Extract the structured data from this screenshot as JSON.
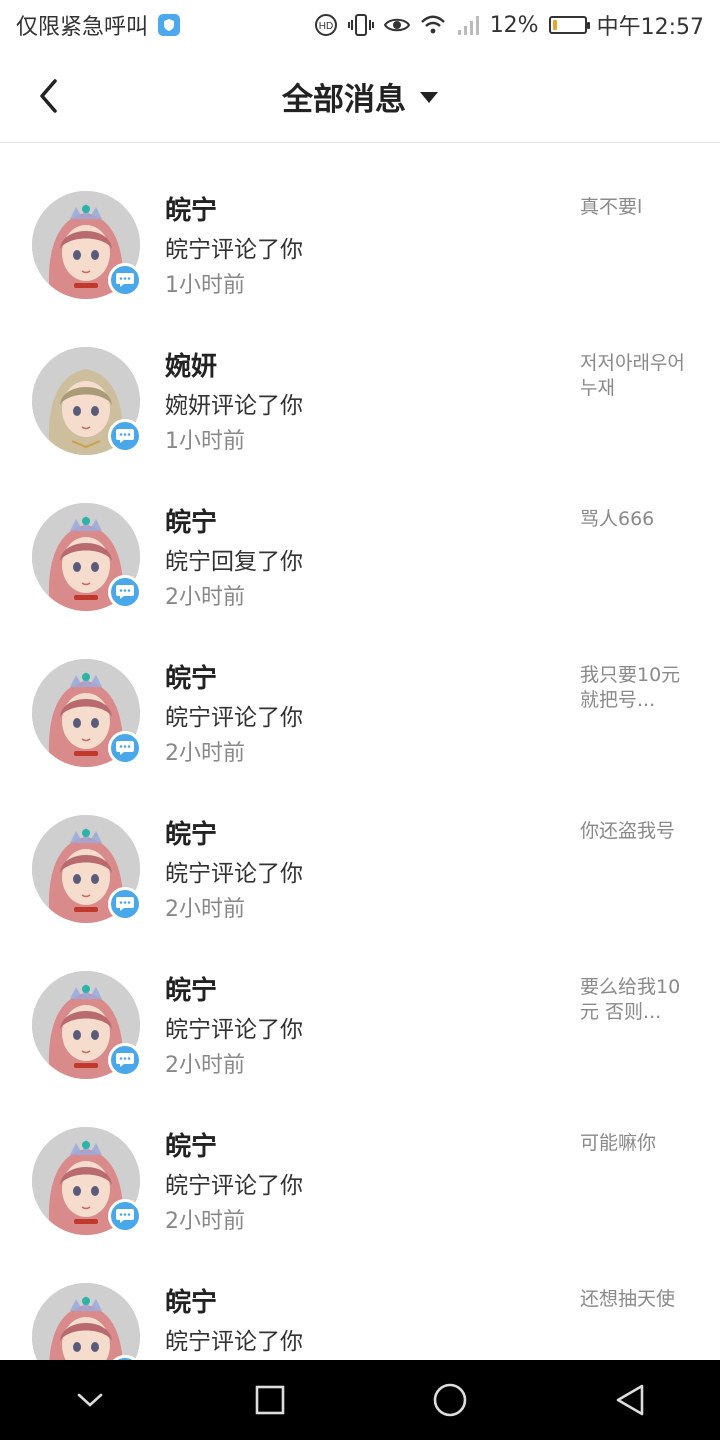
{
  "status_bar": {
    "carrier_text": "仅限紧急呼叫",
    "battery_percent": "12%",
    "battery_level": 0.12,
    "time": "中午12:57",
    "icons": [
      "shield-icon",
      "hd-icon",
      "vibrate-icon",
      "eye-icon",
      "wifi-icon",
      "signal-icon",
      "battery-icon"
    ]
  },
  "header": {
    "title": "全部消息",
    "back_icon": "back-arrow-icon",
    "dropdown_icon": "caret-down-icon"
  },
  "colors": {
    "badge": "#4aa8ea",
    "accent_battery": "#e7a531",
    "nav_bar": "#000000"
  },
  "messages": [
    {
      "name": "皖宁",
      "action": "皖宁评论了你",
      "time": "1小时前",
      "snippet": "真不要l",
      "avatar": "pink-hair-girl"
    },
    {
      "name": "婉妍",
      "action": "婉妍评论了你",
      "time": "1小时前",
      "snippet": "저저아래우어누재",
      "avatar": "blonde-hair-girl"
    },
    {
      "name": "皖宁",
      "action": "皖宁回复了你",
      "time": "2小时前",
      "snippet": "骂人666",
      "avatar": "pink-hair-girl"
    },
    {
      "name": "皖宁",
      "action": "皖宁评论了你",
      "time": "2小时前",
      "snippet": "我只要10元就把号...",
      "avatar": "pink-hair-girl"
    },
    {
      "name": "皖宁",
      "action": "皖宁评论了你",
      "time": "2小时前",
      "snippet": "你还盗我号",
      "avatar": "pink-hair-girl"
    },
    {
      "name": "皖宁",
      "action": "皖宁评论了你",
      "time": "2小时前",
      "snippet": "要么给我10元 否则...",
      "avatar": "pink-hair-girl"
    },
    {
      "name": "皖宁",
      "action": "皖宁评论了你",
      "time": "2小时前",
      "snippet": "可能嘛你",
      "avatar": "pink-hair-girl"
    },
    {
      "name": "皖宁",
      "action": "皖宁评论了你",
      "time": "",
      "snippet": "还想抽天使",
      "avatar": "pink-hair-girl"
    }
  ],
  "nav_bar": {
    "buttons": [
      "collapse-icon",
      "recents-icon",
      "home-icon",
      "back-icon"
    ]
  }
}
